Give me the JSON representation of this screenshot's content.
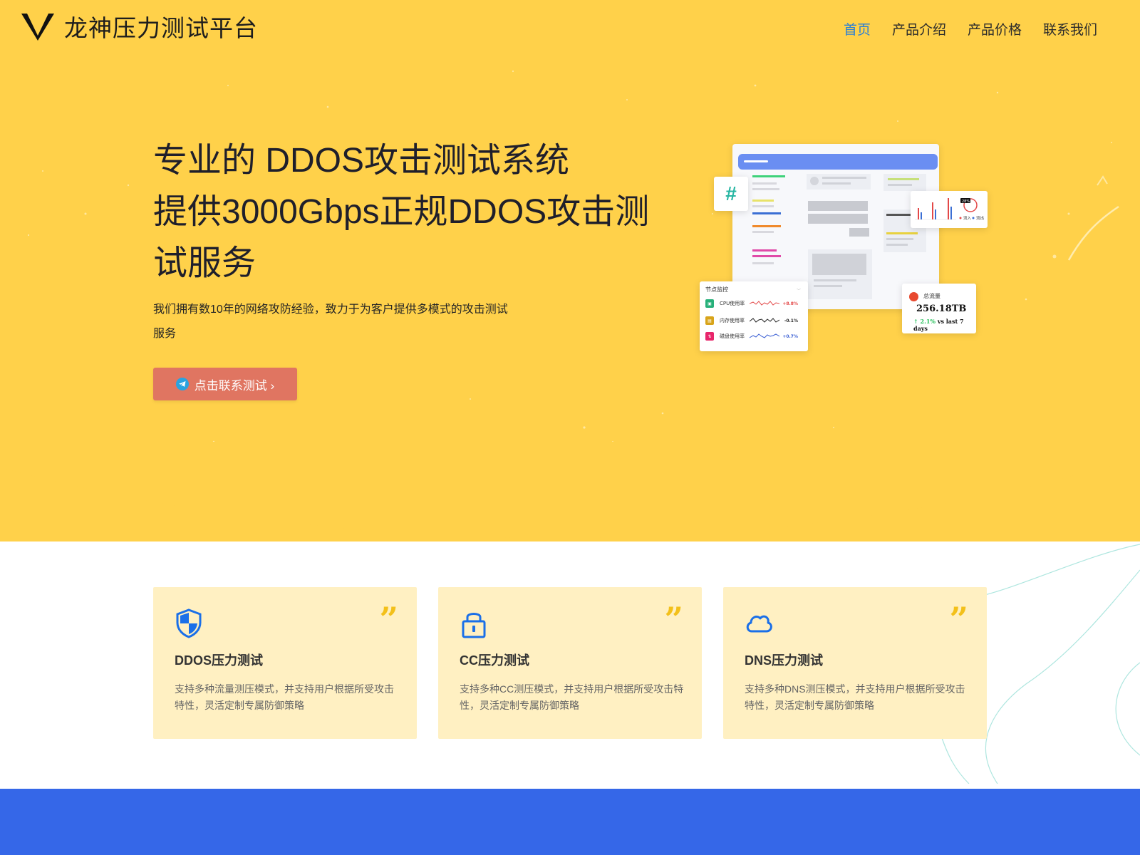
{
  "brand": {
    "name": "龙神压力测试平台",
    "accent": "#f8c62e"
  },
  "nav": {
    "items": [
      {
        "label": "首页",
        "active": true
      },
      {
        "label": "产品介绍",
        "active": false
      },
      {
        "label": "产品价格",
        "active": false
      },
      {
        "label": "联系我们",
        "active": false
      }
    ],
    "active_color": "#2a7fd6"
  },
  "hero": {
    "title_line1": "专业的 DDOS攻击测试系统",
    "title_line2": "提供3000Gbps正规DDOS攻击测",
    "title_line3": "试服务",
    "desc_line1": "我们拥有数10年的网络攻防经验，致力于为客户提供多模式的攻击测试",
    "desc_line2": "服务",
    "cta_label": "点击联系测试 ›",
    "cta_icon": "telegram-icon",
    "cta_color": "#e07561",
    "background_color": "#ffd14a"
  },
  "illustration": {
    "node_card": {
      "title": "节点监控",
      "rows": [
        {
          "label": "CPU使用率",
          "value": "+8.8%",
          "color": "#27b07a"
        },
        {
          "label": "内存使用率",
          "value": "-0.1%",
          "color": "#d8a41a"
        },
        {
          "label": "磁盘使用率",
          "value": "+0.7%",
          "color": "#e8266b"
        }
      ]
    },
    "traffic_card": {
      "label": "总流量",
      "value": "256.18TB",
      "change": "2.1%",
      "change_suffix": "vs last 7 days"
    },
    "chart_card": {
      "legend_in": "流入",
      "legend_out": "流出",
      "badge": "28%"
    }
  },
  "features": [
    {
      "icon": "shield-icon",
      "title": "DDOS压力测试",
      "text": "支持多种流量测压模式，并支持用户根据所受攻击特性，灵活定制专属防御策略"
    },
    {
      "icon": "lock-icon",
      "title": "CC压力测试",
      "text": "支持多种CC测压模式，并支持用户根据所受攻击特性，灵活定制专属防御策略"
    },
    {
      "icon": "cloud-icon",
      "title": "DNS压力测试",
      "text": "支持多种DNS测压模式，并支持用户根据所受攻击特性，灵活定制专属防御策略"
    }
  ],
  "feature_icon_color": "#1a6fe8",
  "quote_glyph": "”",
  "footer_band_color": "#3567e8"
}
